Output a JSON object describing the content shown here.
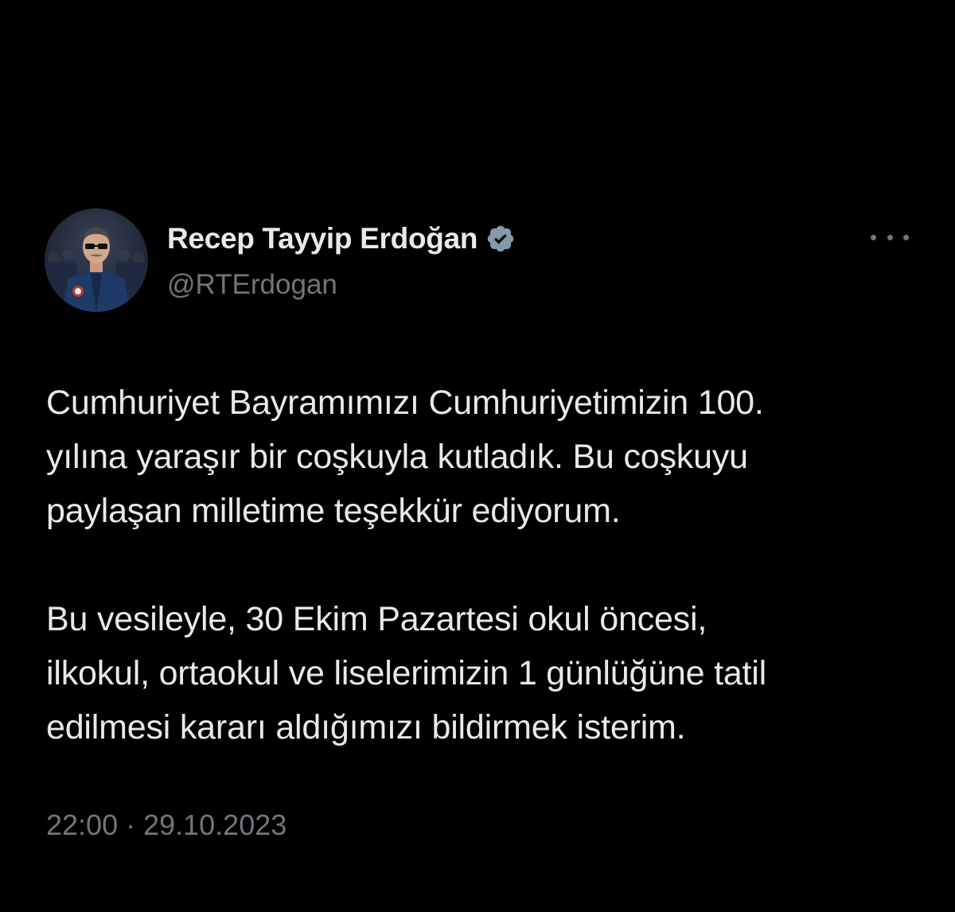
{
  "author": {
    "display_name": "Recep Tayyip Erdoğan",
    "handle": "@RTErdogan",
    "verified_icon": "verified-badge-icon",
    "avatar_icon": "profile-photo"
  },
  "menu": {
    "more_icon": "more-options-icon"
  },
  "tweet": {
    "paragraphs": [
      "Cumhuriyet Bayramımızı Cumhuriyetimizin 100.\nyılına yaraşır bir coşkuyla kutladık. Bu coşkuyu\npaylaşan milletime teşekkür ediyorum.",
      "Bu vesileyle, 30 Ekim Pazartesi okul öncesi,\nilkokul, ortaokul ve liselerimizin 1 günlüğüne tatil\nedilmesi kararı aldığımızı bildirmek isterim."
    ],
    "time": "22:00",
    "separator": " · ",
    "date": "29.10.2023"
  },
  "colors": {
    "background": "#000000",
    "primary_text": "#e7e9ea",
    "secondary_text": "#71767b",
    "verified_badge": "#829aab"
  }
}
